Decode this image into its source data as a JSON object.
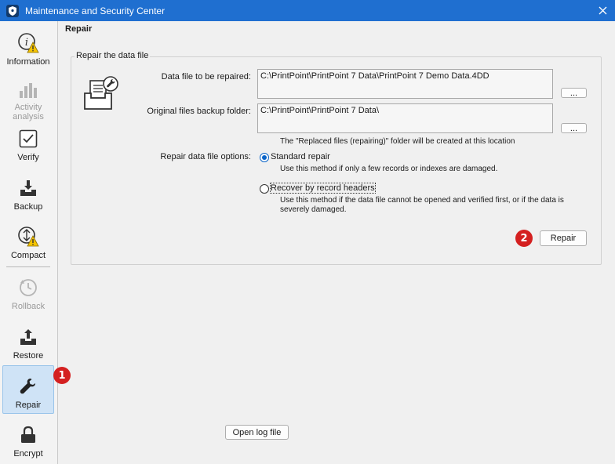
{
  "window": {
    "title": "Maintenance and Security Center"
  },
  "sidebar": {
    "items": [
      {
        "label": "Information",
        "icon": "info-warning-icon",
        "enabled": true
      },
      {
        "label": "Activity analysis",
        "icon": "bar-chart-icon",
        "enabled": false
      },
      {
        "label": "Verify",
        "icon": "checkbox-icon",
        "enabled": true
      },
      {
        "label": "Backup",
        "icon": "download-tray-icon",
        "enabled": true
      },
      {
        "label": "Compact",
        "icon": "compact-warning-icon",
        "enabled": true
      },
      {
        "label": "Rollback",
        "icon": "rollback-icon",
        "enabled": false
      },
      {
        "label": "Restore",
        "icon": "upload-tray-icon",
        "enabled": true
      },
      {
        "label": "Repair",
        "icon": "wrench-icon",
        "enabled": true,
        "selected": true
      },
      {
        "label": "Encrypt",
        "icon": "lock-icon",
        "enabled": true
      }
    ]
  },
  "badges": {
    "step1": "1",
    "step2": "2"
  },
  "main": {
    "page_title": "Repair",
    "group_title": "Repair the data file",
    "data_file_label": "Data file to be repaired:",
    "data_file_value": "C:\\PrintPoint\\PrintPoint 7 Data\\PrintPoint 7 Demo Data.4DD",
    "backup_folder_label": "Original files backup folder:",
    "backup_folder_value": "C:\\PrintPoint\\PrintPoint 7 Data\\",
    "browse_label": "...",
    "backup_note": "The \"Replaced files (repairing)\" folder will be created at this location",
    "options_label": "Repair data file options:",
    "option_standard": "Standard repair",
    "option_standard_desc": "Use this method if only a few records or indexes are damaged.",
    "option_headers": "Recover by record headers",
    "option_headers_desc": "Use this method if the data file cannot be opened and verified first, or if the data is severely damaged.",
    "selected_option": "Standard repair",
    "repair_button": "Repair",
    "open_log_button": "Open log file"
  },
  "colors": {
    "titlebar": "#1f6fd0",
    "accent": "#0a64c8",
    "badge": "#d42020",
    "selected_nav": "#cfe3f6"
  }
}
